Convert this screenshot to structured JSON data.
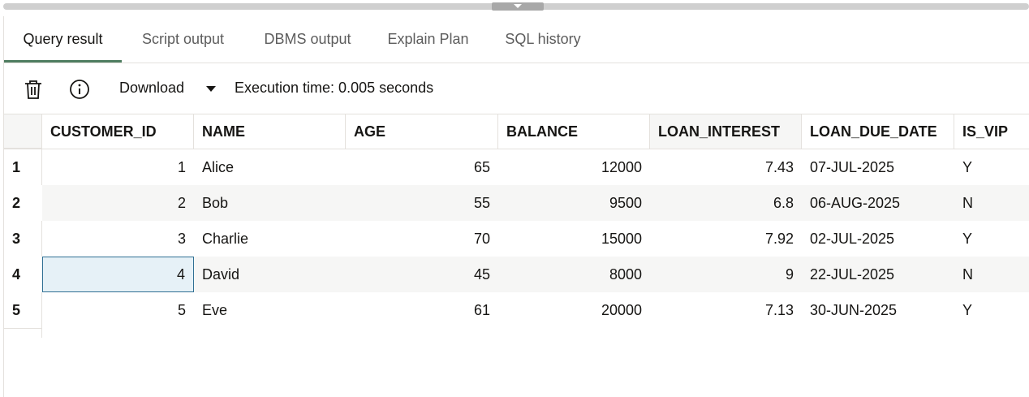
{
  "tabs": [
    {
      "label": "Query result",
      "active": true
    },
    {
      "label": "Script output",
      "active": false
    },
    {
      "label": "DBMS output",
      "active": false
    },
    {
      "label": "Explain Plan",
      "active": false
    },
    {
      "label": "SQL history",
      "active": false
    }
  ],
  "toolbar": {
    "delete_icon": "trash-icon",
    "info_icon": "info-icon",
    "download_label": "Download",
    "execution_time": "Execution time: 0.005 seconds"
  },
  "grid": {
    "columns": [
      "CUSTOMER_ID",
      "NAME",
      "AGE",
      "BALANCE",
      "LOAN_INTEREST",
      "LOAN_DUE_DATE",
      "IS_VIP"
    ],
    "rows": [
      {
        "num": "1",
        "cells": [
          "1",
          "Alice",
          "65",
          "12000",
          "7.43",
          "07-JUL-2025",
          "Y"
        ]
      },
      {
        "num": "2",
        "cells": [
          "2",
          "Bob",
          "55",
          "9500",
          "6.8",
          "06-AUG-2025",
          "N"
        ]
      },
      {
        "num": "3",
        "cells": [
          "3",
          "Charlie",
          "70",
          "15000",
          "7.92",
          "02-JUL-2025",
          "Y"
        ]
      },
      {
        "num": "4",
        "cells": [
          "4",
          "David",
          "45",
          "8000",
          "9",
          "22-JUL-2025",
          "N"
        ]
      },
      {
        "num": "5",
        "cells": [
          "5",
          "Eve",
          "61",
          "20000",
          "7.13",
          "30-JUN-2025",
          "Y"
        ]
      }
    ],
    "selected": {
      "row": 3,
      "col": 0
    }
  },
  "colors": {
    "active_tab_underline": "#4f7d61",
    "selected_cell_bg": "#e6f1f7",
    "selected_cell_border": "#2f6f93",
    "alt_row_bg": "#f6f6f5"
  }
}
